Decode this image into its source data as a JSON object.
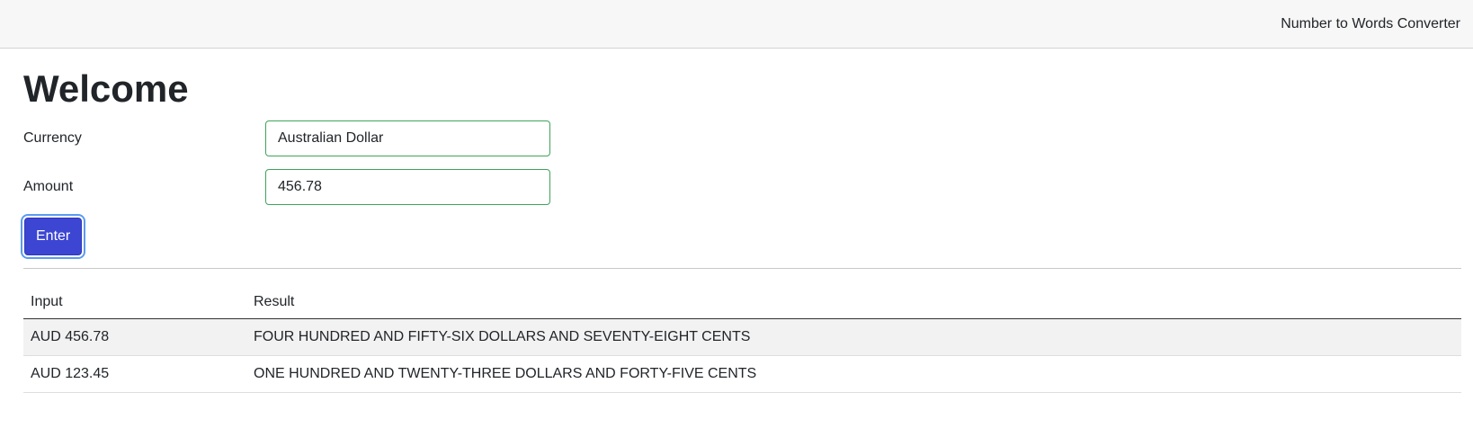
{
  "navbar": {
    "brand": "Number to Words Converter"
  },
  "page": {
    "title": "Welcome"
  },
  "form": {
    "currency_label": "Currency",
    "currency_value": "Australian Dollar",
    "amount_label": "Amount",
    "amount_value": "456.78",
    "enter_label": "Enter"
  },
  "colors": {
    "accent_button": "#3c46d3",
    "valid_input_border": "#3fa35a"
  },
  "results": {
    "headers": {
      "input": "Input",
      "result": "Result"
    },
    "rows": [
      {
        "input": "AUD 456.78",
        "result": "FOUR HUNDRED AND FIFTY-SIX DOLLARS AND SEVENTY-EIGHT CENTS"
      },
      {
        "input": "AUD 123.45",
        "result": "ONE HUNDRED AND TWENTY-THREE DOLLARS AND FORTY-FIVE CENTS"
      }
    ]
  }
}
